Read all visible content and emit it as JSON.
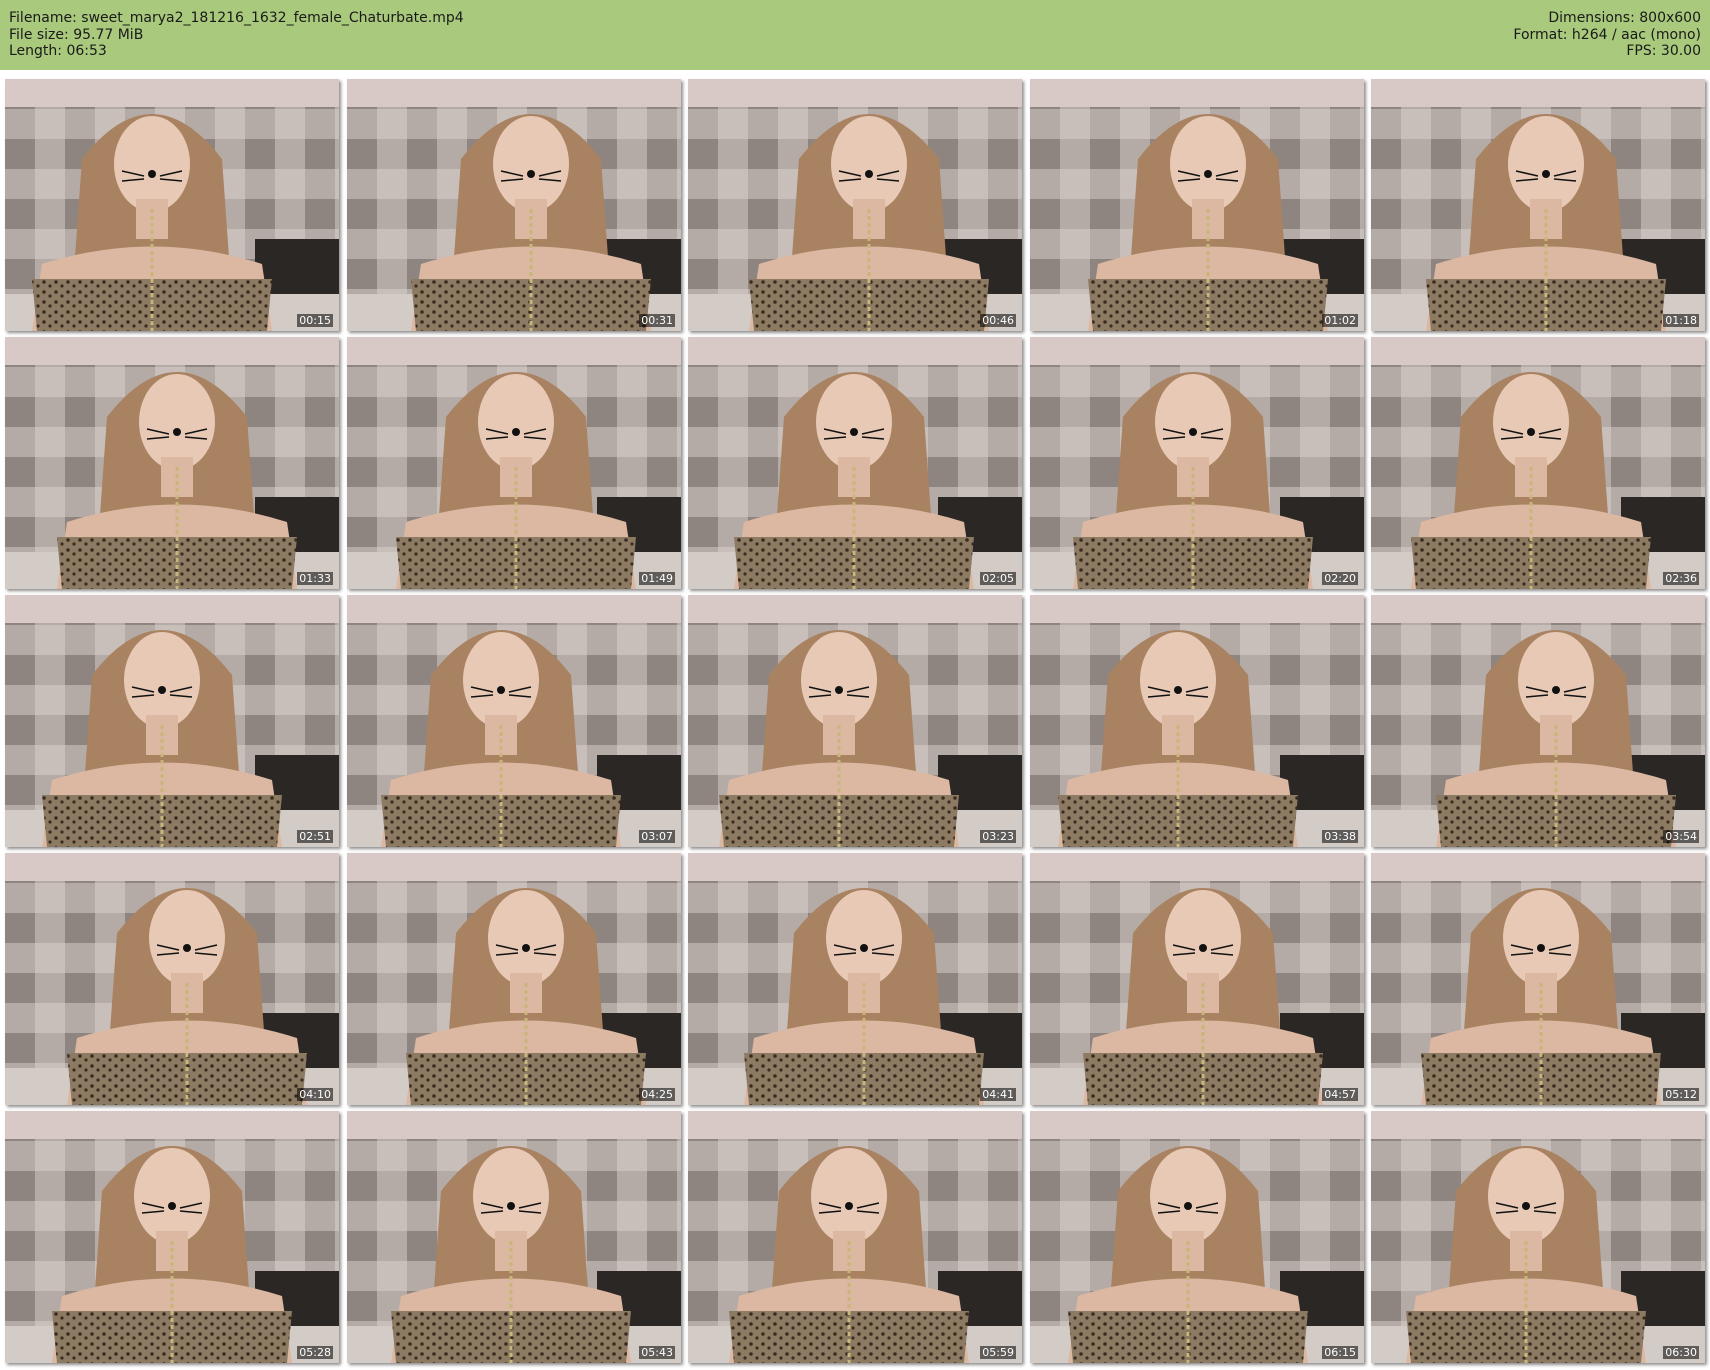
{
  "header": {
    "filename_label": "Filename: sweet_marya2_181216_1632_female_Chaturbate.mp4",
    "filesize_label": "File size: 95.77 MiB",
    "length_label": "Length: 06:53",
    "dimensions_label": "Dimensions: 800x600",
    "format_label": "Format: h264 / aac (mono)",
    "fps_label": "FPS: 30.00",
    "background_color": "#a9c97c"
  },
  "thumbnails": [
    {
      "timestamp": "00:15"
    },
    {
      "timestamp": "00:31"
    },
    {
      "timestamp": "00:46"
    },
    {
      "timestamp": "01:02"
    },
    {
      "timestamp": "01:18"
    },
    {
      "timestamp": "01:33"
    },
    {
      "timestamp": "01:49"
    },
    {
      "timestamp": "02:05"
    },
    {
      "timestamp": "02:20"
    },
    {
      "timestamp": "02:36"
    },
    {
      "timestamp": "02:51"
    },
    {
      "timestamp": "03:07"
    },
    {
      "timestamp": "03:23"
    },
    {
      "timestamp": "03:38"
    },
    {
      "timestamp": "03:54"
    },
    {
      "timestamp": "04:10"
    },
    {
      "timestamp": "04:25"
    },
    {
      "timestamp": "04:41"
    },
    {
      "timestamp": "04:57"
    },
    {
      "timestamp": "05:12"
    },
    {
      "timestamp": "05:28"
    },
    {
      "timestamp": "05:43"
    },
    {
      "timestamp": "05:59"
    },
    {
      "timestamp": "06:15"
    },
    {
      "timestamp": "06:30"
    }
  ]
}
